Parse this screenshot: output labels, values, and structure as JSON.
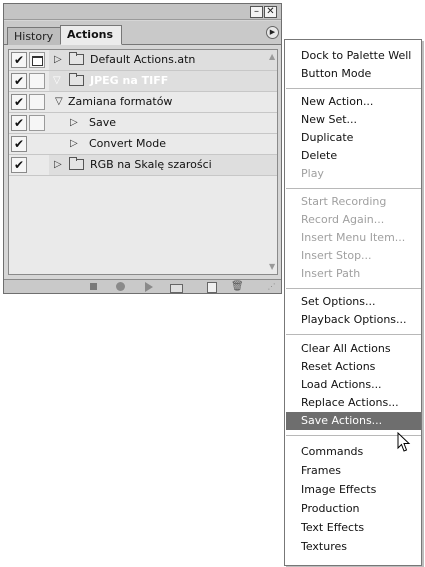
{
  "palette": {
    "tabs": {
      "history": "History",
      "actions": "Actions"
    },
    "window_buttons": {
      "minimize": "–",
      "close": "✕"
    },
    "menu_button": "▶",
    "rows": [
      {
        "label": "Default Actions.atn",
        "checked": true,
        "dialog": true,
        "type": "set",
        "expanded": false
      },
      {
        "label": "JPEG na TIFF",
        "checked": true,
        "dialog": false,
        "type": "set",
        "expanded": true,
        "selected": true
      },
      {
        "label": "Zamiana formatów",
        "checked": true,
        "dialog": false,
        "type": "action",
        "expanded": true
      },
      {
        "label": "Save",
        "checked": true,
        "dialog": false,
        "type": "command",
        "expanded": false
      },
      {
        "label": "Convert Mode",
        "checked": true,
        "dialog": false,
        "type": "command",
        "expanded": false
      },
      {
        "label": "RGB na Skalę szarości",
        "checked": true,
        "dialog": false,
        "type": "set",
        "expanded": false
      }
    ],
    "bottom_buttons": [
      "stop-icon",
      "record-icon",
      "play-icon",
      "new-set-icon",
      "new-action-icon",
      "trash-icon",
      "resize-grip-icon"
    ]
  },
  "flyout": {
    "items": [
      {
        "label": "Dock to Palette Well",
        "enabled": true
      },
      {
        "label": "Button Mode",
        "enabled": true
      },
      {
        "label": "New Action...",
        "enabled": true
      },
      {
        "label": "New Set...",
        "enabled": true
      },
      {
        "label": "Duplicate",
        "enabled": true
      },
      {
        "label": "Delete",
        "enabled": true
      },
      {
        "label": "Play",
        "enabled": false
      },
      {
        "label": "Start Recording",
        "enabled": false
      },
      {
        "label": "Record Again...",
        "enabled": false
      },
      {
        "label": "Insert Menu Item...",
        "enabled": false
      },
      {
        "label": "Insert Stop...",
        "enabled": false
      },
      {
        "label": "Insert Path",
        "enabled": false
      },
      {
        "label": "Set Options...",
        "enabled": true
      },
      {
        "label": "Playback Options...",
        "enabled": true
      },
      {
        "label": "Clear All Actions",
        "enabled": true
      },
      {
        "label": "Reset Actions",
        "enabled": true
      },
      {
        "label": "Load Actions...",
        "enabled": true
      },
      {
        "label": "Replace Actions...",
        "enabled": true
      },
      {
        "label": "Save Actions...",
        "enabled": true,
        "highlighted": true
      },
      {
        "label": "Commands",
        "enabled": true
      },
      {
        "label": "Frames",
        "enabled": true
      },
      {
        "label": "Image Effects",
        "enabled": true
      },
      {
        "label": "Production",
        "enabled": true
      },
      {
        "label": "Text Effects",
        "enabled": true
      },
      {
        "label": "Textures",
        "enabled": true
      }
    ]
  },
  "colors": {
    "highlight": "#6e6e6e",
    "selected_row": "#7c7c7c",
    "disabled_text": "#a0a0a0"
  }
}
